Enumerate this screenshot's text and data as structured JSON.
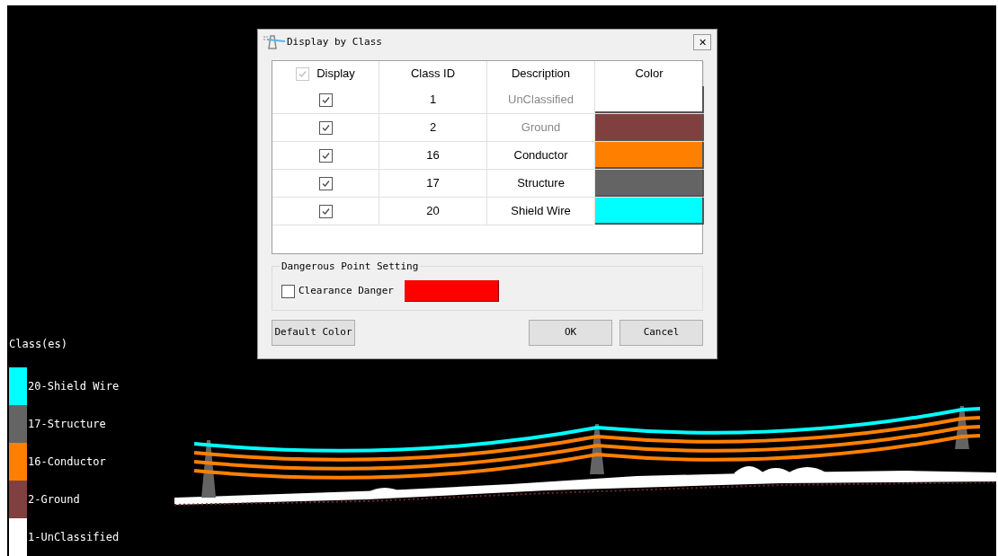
{
  "dialog": {
    "title": "Display by Class",
    "close": "✕",
    "table": {
      "columns": [
        "Display",
        "Class ID",
        "Description",
        "Color"
      ],
      "header_checked": true,
      "rows": [
        {
          "checked": true,
          "class_id": "1",
          "description": "UnClassified",
          "dimmed": true,
          "color": "#ffffff"
        },
        {
          "checked": true,
          "class_id": "2",
          "description": "Ground",
          "dimmed": true,
          "color": "#804040"
        },
        {
          "checked": true,
          "class_id": "16",
          "description": "Conductor",
          "dimmed": false,
          "color": "#ff8000"
        },
        {
          "checked": true,
          "class_id": "17",
          "description": "Structure",
          "dimmed": false,
          "color": "#646464"
        },
        {
          "checked": true,
          "class_id": "20",
          "description": "Shield Wire",
          "dimmed": false,
          "color": "#00ffff"
        }
      ]
    },
    "danger": {
      "title": "Dangerous Point Setting",
      "label": "Clearance Danger",
      "checked": false,
      "color": "#ff0000"
    },
    "buttons": {
      "default": "Default Color",
      "ok": "OK",
      "cancel": "Cancel"
    }
  },
  "legend": {
    "title": "Class(es)",
    "items": [
      {
        "label": "20-Shield Wire",
        "color": "#00ffff"
      },
      {
        "label": "17-Structure",
        "color": "#646464"
      },
      {
        "label": "16-Conductor",
        "color": "#ff8000"
      },
      {
        "label": "2-Ground",
        "color": "#804040"
      },
      {
        "label": "1-UnClassified",
        "color": "#ffffff"
      }
    ]
  }
}
